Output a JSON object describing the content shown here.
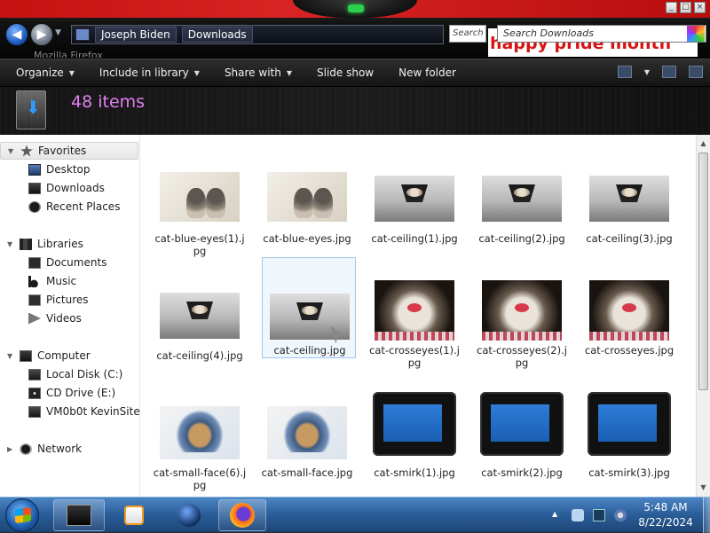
{
  "window": {
    "ghost_title": "Mozilla Firefox",
    "controls": [
      "_",
      "□",
      "×"
    ]
  },
  "address": {
    "crumbs": [
      "Joseph Biden",
      "Downloads"
    ],
    "search_chip": "Search",
    "search_placeholder": "Search Downloads",
    "banner_text": "happy pride month"
  },
  "toolbar": {
    "organize": "Organize",
    "include": "Include in library",
    "share": "Share with",
    "slideshow": "Slide show",
    "newfolder": "New folder"
  },
  "header": {
    "item_count": "48 items"
  },
  "nav": {
    "favorites": "Favorites",
    "desktop": "Desktop",
    "downloads": "Downloads",
    "recent": "Recent Places",
    "libraries": "Libraries",
    "documents": "Documents",
    "music": "Music",
    "pictures": "Pictures",
    "videos": "Videos",
    "computer": "Computer",
    "local_disk": "Local Disk (C:)",
    "cd_drive": "CD Drive (E:)",
    "kevinsite": "VM0b0t KevinSite",
    "network": "Network"
  },
  "files": [
    {
      "name": "cat-blue-eyes(1).jpg",
      "thumb": "kittens"
    },
    {
      "name": "cat-blue-eyes.jpg",
      "thumb": "kittens"
    },
    {
      "name": "cat-ceiling(1).jpg",
      "thumb": "ceiling"
    },
    {
      "name": "cat-ceiling(2).jpg",
      "thumb": "ceiling"
    },
    {
      "name": "cat-ceiling(3).jpg",
      "thumb": "ceiling"
    },
    {
      "name": "cat-ceiling(4).jpg",
      "thumb": "ceiling"
    },
    {
      "name": "cat-ceiling.jpg",
      "thumb": "ceiling",
      "selected": true
    },
    {
      "name": "cat-crosseyes(1).jpg",
      "thumb": "crosseyes"
    },
    {
      "name": "cat-crosseyes(2).jpg",
      "thumb": "crosseyes"
    },
    {
      "name": "cat-crosseyes.jpg",
      "thumb": "crosseyes"
    },
    {
      "name": "cat-small-face(6).jpg",
      "thumb": "small-face"
    },
    {
      "name": "cat-small-face.jpg",
      "thumb": "small-face"
    },
    {
      "name": "cat-smirk(1).jpg",
      "thumb": "smirk"
    },
    {
      "name": "cat-smirk(2).jpg",
      "thumb": "smirk"
    },
    {
      "name": "cat-smirk(3).jpg",
      "thumb": "smirk"
    }
  ],
  "taskbar": {
    "time": "5:48 AM",
    "date": "8/22/2024",
    "pinned": [
      "explorer-icon",
      "media-player-icon",
      "globe-icon",
      "firefox-icon"
    ]
  },
  "colors": {
    "accent_red": "#c61111",
    "item_count_pink": "#e080f0",
    "taskbar_blue": "#2a5d98",
    "selection_blue": "#9fc6ea"
  }
}
